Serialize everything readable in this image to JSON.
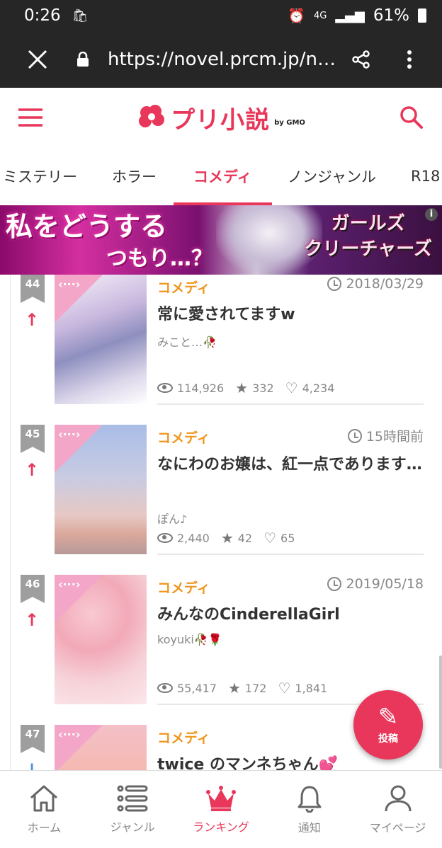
{
  "status": {
    "time": "0:26",
    "network": "4G",
    "battery": "61%"
  },
  "browser": {
    "url": "https://novel.prcm.jp/nove…"
  },
  "header": {
    "logo": "プリ小説",
    "logo_by": "by GMO"
  },
  "tabs": [
    {
      "label": "ミステリー",
      "active": false
    },
    {
      "label": "ホラー",
      "active": false
    },
    {
      "label": "コメディ",
      "active": true
    },
    {
      "label": "ノンジャンル",
      "active": false
    },
    {
      "label": "R18",
      "active": false
    }
  ],
  "banner": {
    "copy_line1": "私をどうする",
    "copy_line2": "つもり…？",
    "game_title_line1": "ガールズ",
    "game_title_line2": "クリーチャーズ",
    "info": "i"
  },
  "items": [
    {
      "rank": "44",
      "trend": "↑",
      "genre": "コメディ",
      "date": "2018/03/29",
      "title": "常に愛されてますw",
      "author": "みこと…🥀",
      "views": "114,926",
      "stars": "332",
      "likes": "4,234"
    },
    {
      "rank": "45",
      "trend": "↑",
      "genre": "コメディ",
      "date": "15時間前",
      "title": "なにわのお嬢は、紅一点であります…",
      "author": "ぽん♪",
      "views": "2,440",
      "stars": "42",
      "likes": "65"
    },
    {
      "rank": "46",
      "trend": "↑",
      "genre": "コメディ",
      "date": "2019/05/18",
      "title": "みんなのCinderellaGirl",
      "author": "koyuki🥀🌹",
      "views": "55,417",
      "stars": "172",
      "likes": "1,841"
    },
    {
      "rank": "47",
      "trend": "↓",
      "genre": "コメディ",
      "date": "",
      "title": "twice のマンネちゃん💕",
      "author": "",
      "views": "",
      "stars": "",
      "likes": ""
    }
  ],
  "fab": {
    "label": "投稿"
  },
  "bottom_nav": [
    {
      "label": "ホーム",
      "icon": "home-icon",
      "active": false
    },
    {
      "label": "ジャンル",
      "icon": "list-icon",
      "active": false
    },
    {
      "label": "ランキング",
      "icon": "crown-icon",
      "active": true
    },
    {
      "label": "通知",
      "icon": "bell-icon",
      "active": false
    },
    {
      "label": "マイページ",
      "icon": "person-icon",
      "active": false
    }
  ],
  "colors": {
    "brand": "#e8375a",
    "genre": "#f0951d",
    "status_bg": "#262626"
  }
}
